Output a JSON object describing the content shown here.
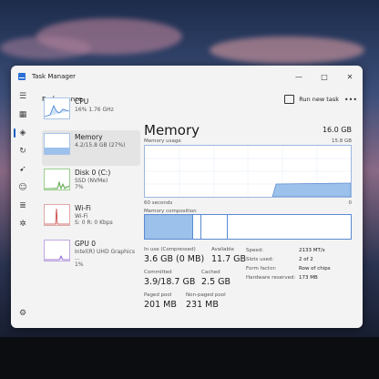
{
  "window": {
    "title": "Task Manager",
    "minimize": "—",
    "maximize": "□",
    "close": "✕"
  },
  "header": {
    "section": "Performance",
    "run_task": "Run new task",
    "more": "•••"
  },
  "sidebar": {
    "icons": [
      "menu-icon",
      "processes-icon",
      "performance-icon",
      "history-icon",
      "startup-icon",
      "users-icon",
      "details-icon",
      "services-icon",
      "settings-icon"
    ]
  },
  "perf_list": [
    {
      "name": "CPU",
      "line1": "16%  1.76 GHz",
      "line2": ""
    },
    {
      "name": "Memory",
      "line1": "4.2/15.8 GB (27%)",
      "line2": ""
    },
    {
      "name": "Disk 0 (C:)",
      "line1": "SSD (NVMe)",
      "line2": "7%"
    },
    {
      "name": "Wi-Fi",
      "line1": "Wi-Fi",
      "line2": "S: 0 R: 0 Kbps"
    },
    {
      "name": "GPU 0",
      "line1": "Intel(R) UHD Graphics ...",
      "line2": "1%"
    }
  ],
  "memory": {
    "title": "Memory",
    "total": "16.0 GB",
    "usage_label": "Memory usage",
    "usage_max": "15.8 GB",
    "time_left": "60 seconds",
    "time_right": "0",
    "composition_label": "Memory composition",
    "stats": {
      "in_use_label": "In use (Compressed)",
      "in_use": "3.6 GB (0 MB)",
      "available_label": "Available",
      "available": "11.7 GB",
      "committed_label": "Committed",
      "committed": "3.9/18.7 GB",
      "cached_label": "Cached",
      "cached": "2.5 GB",
      "paged_label": "Paged pool",
      "paged": "201 MB",
      "nonpaged_label": "Non-paged pool",
      "nonpaged": "231 MB"
    },
    "right": [
      {
        "label": "Speed:",
        "value": "2133 MT/s"
      },
      {
        "label": "Slots used:",
        "value": "2 of 2"
      },
      {
        "label": "Form factor:",
        "value": "Row of chips"
      },
      {
        "label": "Hardware reserved:",
        "value": "173 MB"
      }
    ]
  },
  "colors": {
    "accent": "#1d5fc6",
    "memory_fill": "#9cc1ea",
    "memory_border": "#5a89d2"
  }
}
